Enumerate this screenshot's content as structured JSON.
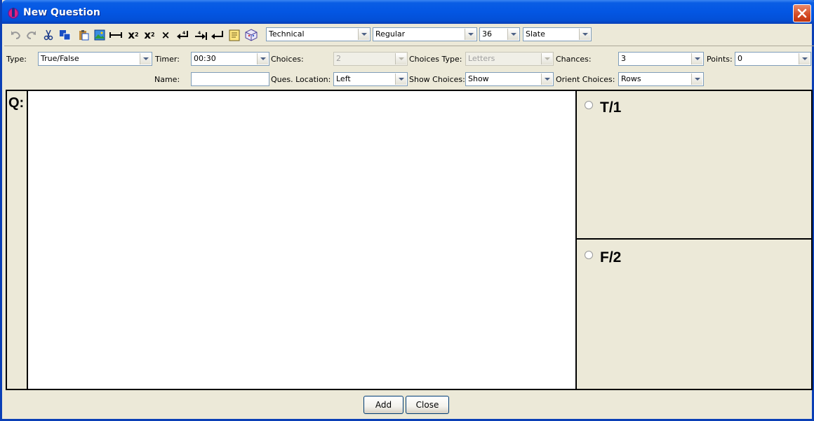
{
  "window": {
    "title": "New Question"
  },
  "toolbar": {
    "icons": [
      "undo-icon",
      "redo-icon",
      "cut-icon",
      "copy-icon",
      "paste-icon",
      "image-icon",
      "line-icon",
      "subscript-icon",
      "superscript-icon",
      "clear-format-icon",
      "return-icon",
      "tab-icon",
      "enter-icon",
      "notes-icon",
      "3d-object-icon"
    ],
    "font_family": "Technical",
    "font_style": "Regular",
    "font_size": "36",
    "font_color": "Slate"
  },
  "settings": {
    "type_label": "Type:",
    "type_value": "True/False",
    "timer_label": "Timer:",
    "timer_value": "00:30",
    "choices_label": "Choices:",
    "choices_value": "2",
    "choices_type_label": "Choices Type:",
    "choices_type_value": "Letters",
    "chances_label": "Chances:",
    "chances_value": "3",
    "points_label": "Points:",
    "points_value": "0",
    "name_label": "Name:",
    "name_value": "",
    "ques_location_label": "Ques. Location:",
    "ques_location_value": "Left",
    "show_choices_label": "Show Choices:",
    "show_choices_value": "Show",
    "orient_choices_label": "Orient Choices:",
    "orient_choices_value": "Rows"
  },
  "question": {
    "label": "Q:"
  },
  "choices": [
    {
      "label": "T/1"
    },
    {
      "label": "F/2"
    }
  ],
  "buttons": {
    "add": "Add",
    "close": "Close"
  },
  "colors": {
    "titlebar": "#0356E3",
    "window_bg": "#ECE9D8",
    "close_button": "#D44A23"
  }
}
